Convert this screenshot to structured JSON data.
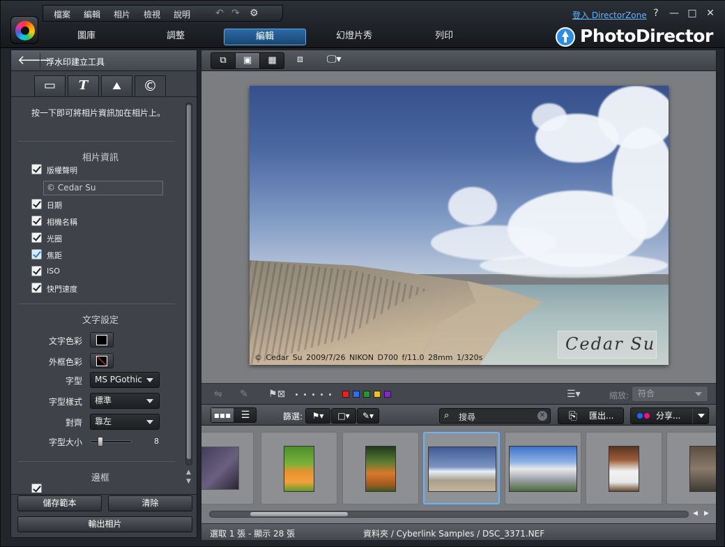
{
  "menu": {
    "items": [
      "檔案",
      "編輯",
      "相片",
      "檢視",
      "說明"
    ]
  },
  "account": {
    "login_link": "登入 DirectorZone"
  },
  "window_buttons": {
    "help": "?",
    "minimize": "—",
    "maximize": "□",
    "close": "✕"
  },
  "modes": {
    "tabs": [
      {
        "label": "圖庫",
        "active": false
      },
      {
        "label": "調整",
        "active": false
      },
      {
        "label": "編輯",
        "active": true
      },
      {
        "label": "幻燈片秀",
        "active": false
      },
      {
        "label": "列印",
        "active": false
      }
    ]
  },
  "brand": {
    "name": "PhotoDirector"
  },
  "left_panel": {
    "title": "浮水印建立工具",
    "tabs": [
      {
        "icon": "rectangle-icon",
        "glyph": "▭"
      },
      {
        "icon": "text-icon",
        "glyph": "T"
      },
      {
        "icon": "image-icon",
        "glyph": "⛰"
      },
      {
        "icon": "copyright-icon",
        "glyph": "©",
        "active": true
      }
    ],
    "description": "按一下即可將相片資訊加在相片上。",
    "photo_info": {
      "title": "相片資訊",
      "copyright_label": "版權聲明",
      "copyright_value": "© Cedar Su",
      "items": [
        {
          "label": "日期",
          "checked": true
        },
        {
          "label": "相機名稱",
          "checked": true
        },
        {
          "label": "光圈",
          "checked": true
        },
        {
          "label": "焦距",
          "checked": true
        },
        {
          "label": "ISO",
          "checked": true
        },
        {
          "label": "快門速度",
          "checked": true
        }
      ]
    },
    "text_settings": {
      "title": "文字設定",
      "text_color_label": "文字色彩",
      "text_color": "#000000",
      "border_color_label": "外框色彩",
      "font_label": "字型",
      "font_value": "MS PGothic",
      "font_style_label": "字型樣式",
      "font_style_value": "標準",
      "align_label": "對齊",
      "align_value": "靠左",
      "size_label": "字型大小",
      "size_value": "8"
    },
    "border_section": {
      "title": "邊框"
    },
    "buttons": {
      "save_template": "儲存範本",
      "clear": "清除",
      "export": "輸出相片"
    }
  },
  "viewer": {
    "exif_text": "© Cedar Su  2009/7/26  NIKON D700  f/11.0  28mm  1/320s",
    "signature": "Cedar Su"
  },
  "edit_bar": {
    "flag_colors": [
      "#ff1b1b",
      "#2a6dff",
      "#1e9a2a",
      "#f7c400",
      "#8a22d6"
    ],
    "zoom_label": "縮放:",
    "zoom_value": "符合"
  },
  "filter_bar": {
    "filter_label": "篩選:",
    "search_placeholder": "搜尋",
    "export_label": "匯出...",
    "share_label": "分享..."
  },
  "filmstrip": {
    "selected_index": 3
  },
  "status": {
    "selection": "選取 1 張 - 顯示 28 張",
    "path": "資料夾 / Cyberlink Samples / DSC_3371.NEF"
  }
}
